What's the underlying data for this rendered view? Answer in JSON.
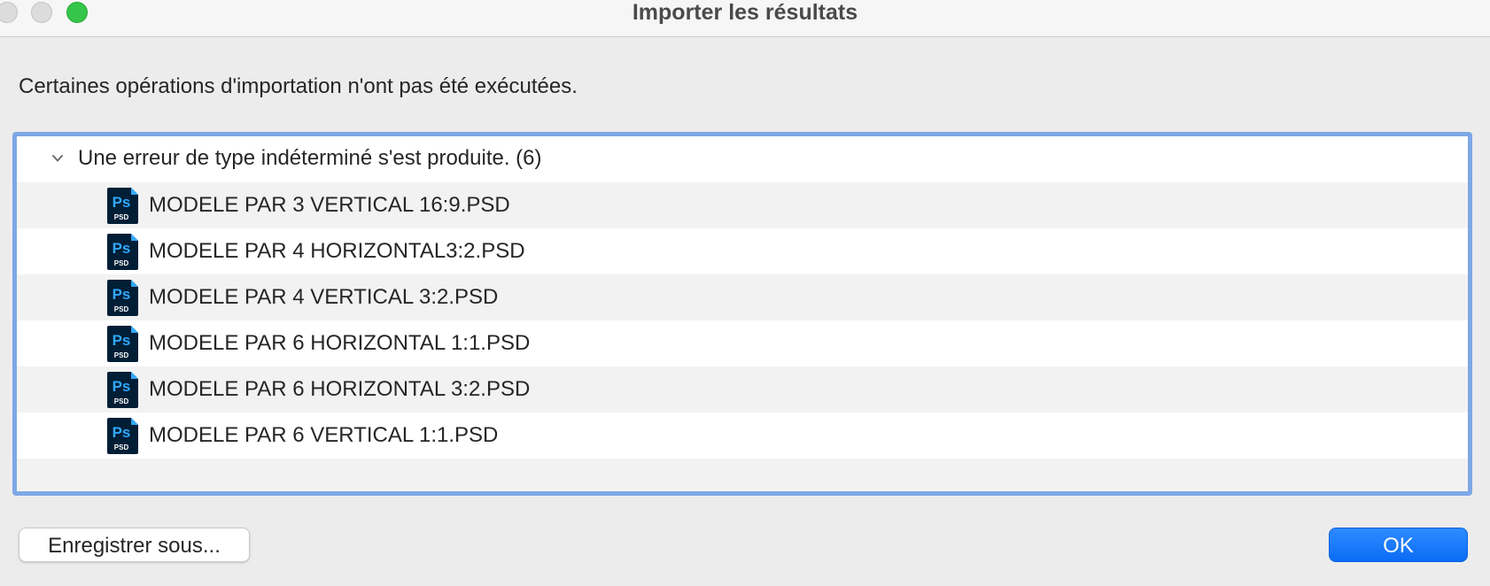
{
  "window": {
    "title": "Importer les résultats"
  },
  "message": "Certaines opérations d'importation n'ont pas été exécutées.",
  "results": {
    "group_label": "Une erreur de type indéterminé s'est produite. (6)",
    "expanded": true,
    "files": [
      {
        "name": "MODELE PAR 3 VERTICAL 16:9.PSD",
        "icon": "photoshop-psd-icon"
      },
      {
        "name": "MODELE PAR 4 HORIZONTAL3:2.PSD",
        "icon": "photoshop-psd-icon"
      },
      {
        "name": "MODELE PAR 4 VERTICAL 3:2.PSD",
        "icon": "photoshop-psd-icon"
      },
      {
        "name": "MODELE PAR 6 HORIZONTAL 1:1.PSD",
        "icon": "photoshop-psd-icon"
      },
      {
        "name": "MODELE PAR 6 HORIZONTAL 3:2.PSD",
        "icon": "photoshop-psd-icon"
      },
      {
        "name": "MODELE PAR 6 VERTICAL 1:1.PSD",
        "icon": "photoshop-psd-icon"
      }
    ]
  },
  "psd_icon": {
    "glyph": "Ps",
    "caption": "PSD"
  },
  "buttons": {
    "save_as": "Enregistrer sous...",
    "ok": "OK"
  },
  "colors": {
    "accent": "#0a6cf5",
    "list_focus_ring": "#7ea7e6",
    "ps_icon_bg": "#001e36",
    "ps_icon_text": "#31a8ff",
    "zoom_button": "#35c649"
  }
}
